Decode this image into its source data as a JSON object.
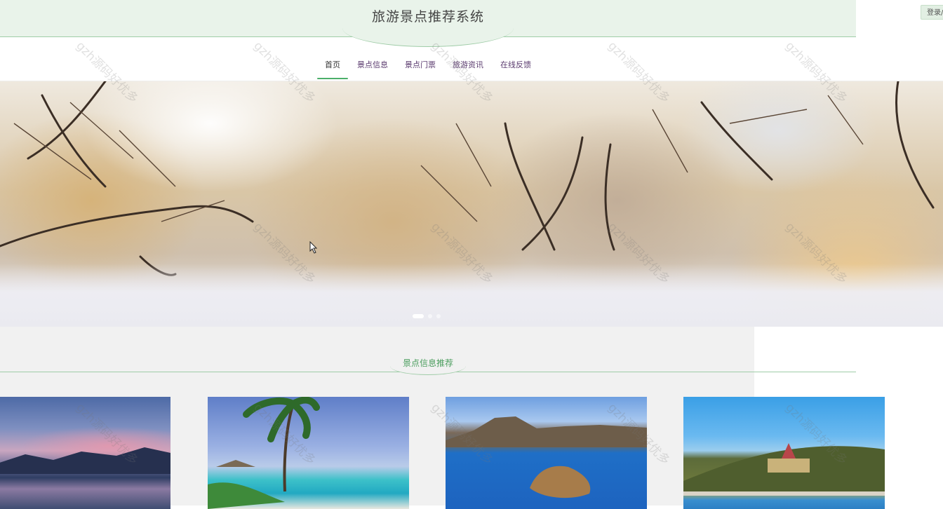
{
  "header": {
    "title": "旅游景点推荐系统",
    "login_label": "登录/注册"
  },
  "nav": {
    "items": [
      {
        "label": "首页",
        "active": true
      },
      {
        "label": "景点信息",
        "active": false
      },
      {
        "label": "景点门票",
        "active": false
      },
      {
        "label": "旅游资讯",
        "active": false
      },
      {
        "label": "在线反馈",
        "active": false
      }
    ]
  },
  "banner": {
    "slide_count": 3,
    "active_slide": 1
  },
  "section": {
    "title": "景点信息推荐"
  },
  "watermark": {
    "text": "gzh源码好优多"
  },
  "colors": {
    "accent": "#4caf6a",
    "header_bg": "#e9f3ea",
    "section_title": "#4a9d5d"
  },
  "icons": {
    "cursor": "mouse-pointer-icon"
  }
}
